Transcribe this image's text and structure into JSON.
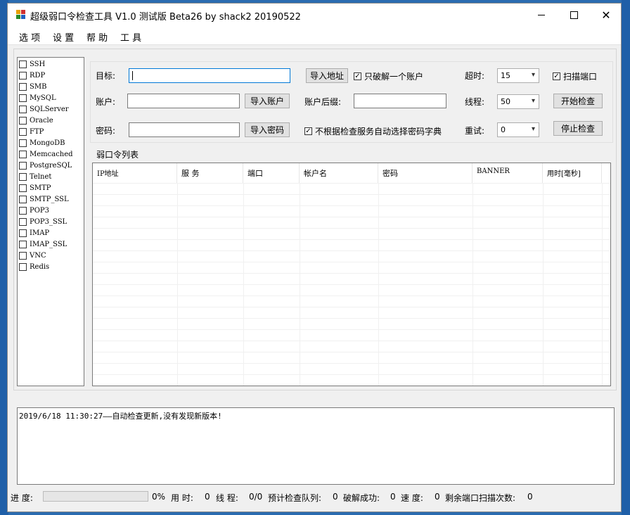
{
  "window": {
    "title": "超级弱口令检查工具 V1.0 测试版 Beta26 by shack2 20190522"
  },
  "menu": [
    "选 项",
    "设 置",
    "帮 助",
    "工 具"
  ],
  "services": [
    {
      "label": "SSH",
      "checked": false
    },
    {
      "label": "RDP",
      "checked": false
    },
    {
      "label": "SMB",
      "checked": false
    },
    {
      "label": "MySQL",
      "checked": false
    },
    {
      "label": "SQLServer",
      "checked": false
    },
    {
      "label": "Oracle",
      "checked": false
    },
    {
      "label": "FTP",
      "checked": false
    },
    {
      "label": "MongoDB",
      "checked": false
    },
    {
      "label": "Memcached",
      "checked": false
    },
    {
      "label": "PostgreSQL",
      "checked": false
    },
    {
      "label": "Telnet",
      "checked": false
    },
    {
      "label": "SMTP",
      "checked": false
    },
    {
      "label": "SMTP_SSL",
      "checked": false
    },
    {
      "label": "POP3",
      "checked": false
    },
    {
      "label": "POP3_SSL",
      "checked": false
    },
    {
      "label": "IMAP",
      "checked": false
    },
    {
      "label": "IMAP_SSL",
      "checked": false
    },
    {
      "label": "VNC",
      "checked": false
    },
    {
      "label": "Redis",
      "checked": false
    }
  ],
  "form": {
    "target_label": "目标:",
    "target_value": "",
    "import_address": "导入地址",
    "only_one_account": "只破解一个账户",
    "only_one_checked": true,
    "timeout_label": "超时:",
    "timeout_value": "15",
    "scan_port": "扫描端口",
    "scan_port_checked": true,
    "account_label": "账户:",
    "account_value": "",
    "import_account": "导入账户",
    "suffix_label": "账户后缀:",
    "suffix_value": "",
    "threads_label": "线程:",
    "threads_value": "50",
    "start_check": "开始检查",
    "password_label": "密码:",
    "password_value": "",
    "import_password": "导入密码",
    "no_auto_dict": "不根据检查服务自动选择密码字典",
    "no_auto_dict_checked": true,
    "retry_label": "重试:",
    "retry_value": "0",
    "stop_check": "停止检查"
  },
  "results": {
    "group_title": "弱口令列表",
    "columns": [
      "IP地址",
      "服 务",
      "端口",
      "帐户名",
      "密码",
      "BANNER",
      "用时[毫秒]"
    ],
    "rows": []
  },
  "log": {
    "text": "2019/6/18 11:30:27——自动检查更新,没有发现新版本!"
  },
  "status": {
    "progress_label": "进 度:",
    "progress_value": "0%",
    "progress_fraction": 0,
    "time_label": "用 时:",
    "time_value": "0",
    "thread_label": "线 程:",
    "thread_value": "0/0",
    "queue_label": "预计检查队列:",
    "queue_value": "0",
    "success_label": "破解成功:",
    "success_value": "0",
    "speed_label": "速 度:",
    "speed_value": "0",
    "remain_label": "剩余端口扫描次数:",
    "remain_value": "0"
  },
  "colors": {
    "accent": "#0078d7",
    "progress": "#06b025",
    "window_bg": "#f0f0f0"
  }
}
